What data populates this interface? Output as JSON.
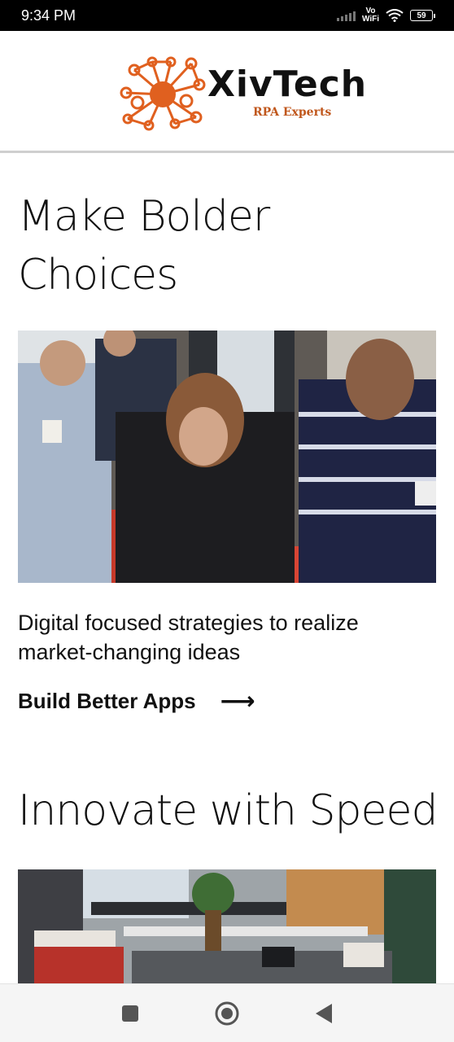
{
  "status_bar": {
    "time": "9:34 PM",
    "vowifi_top": "Vo",
    "vowifi_bottom": "WiFi",
    "battery": "59"
  },
  "header": {
    "logo_name": "XivTech",
    "logo_tagline": "RPA Experts",
    "brand_color": "#e0601f"
  },
  "section1": {
    "heading": "Make Bolder Choices",
    "image_icon": "team-collaboration-photo",
    "tagline": "Digital focused strategies to realize market-changing ideas",
    "cta_label": "Build Better Apps",
    "cta_icon": "arrow-right-icon"
  },
  "section2": {
    "heading": "Innovate with Speed",
    "image_icon": "office-space-photo"
  },
  "nav": {
    "recent_icon": "square-icon",
    "home_icon": "circle-home-icon",
    "back_icon": "triangle-back-icon"
  }
}
